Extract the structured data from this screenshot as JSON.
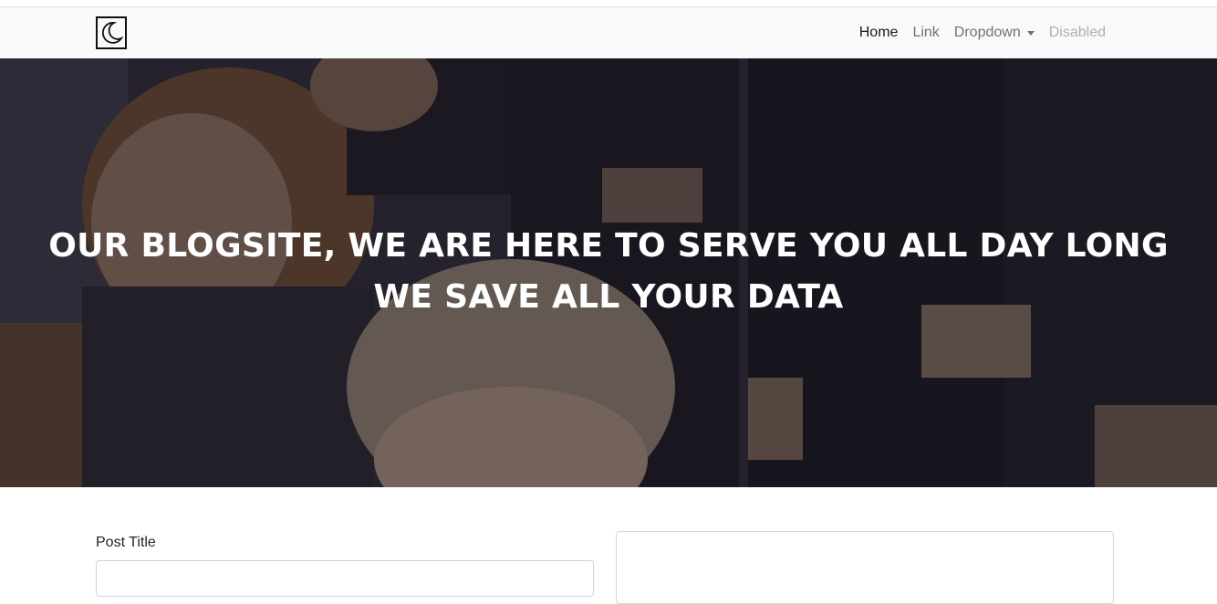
{
  "navbar": {
    "brand_icon": "crescent-moon-icon",
    "items": [
      {
        "label": "Home",
        "state": "active"
      },
      {
        "label": "Link",
        "state": "normal"
      },
      {
        "label": "Dropdown",
        "state": "normal"
      },
      {
        "label": "Disabled",
        "state": "disabled"
      }
    ]
  },
  "hero": {
    "line1": "OUR BLOGSITE, WE ARE HERE TO SERVE YOU ALL DAY LONG",
    "line2": "WE SAVE ALL YOUR DATA"
  },
  "form": {
    "post_title_label": "Post Title",
    "post_title_value": ""
  },
  "colors": {
    "navbar_bg": "#f8f9fa",
    "hero_text": "#ffffff"
  }
}
